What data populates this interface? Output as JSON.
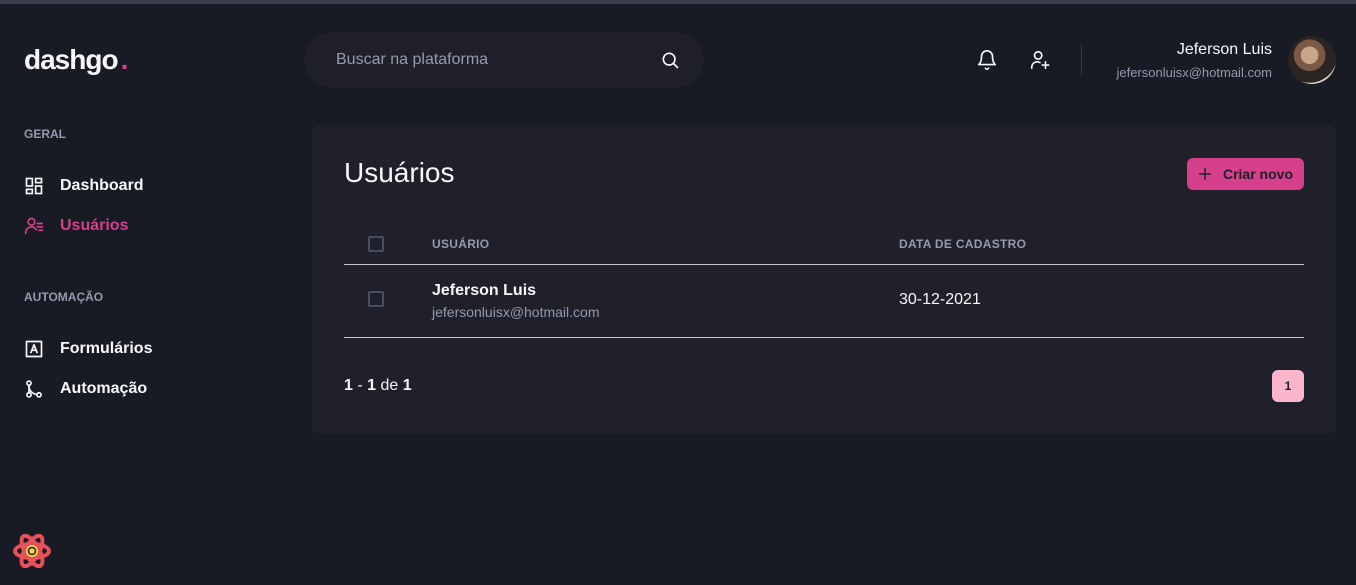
{
  "header": {
    "logo_text": "dashgo",
    "logo_dot": ".",
    "search_placeholder": "Buscar na plataforma",
    "user": {
      "name": "Jeferson Luis",
      "email": "jefersonluisx@hotmail.com"
    }
  },
  "sidebar": {
    "sections": [
      {
        "title": "GERAL",
        "items": [
          {
            "label": "Dashboard",
            "icon": "dashboard-icon",
            "active": false
          },
          {
            "label": "Usuários",
            "icon": "users-icon",
            "active": true
          }
        ]
      },
      {
        "title": "AUTOMAÇÃO",
        "items": [
          {
            "label": "Formulários",
            "icon": "form-icon",
            "active": false
          },
          {
            "label": "Automação",
            "icon": "git-merge-icon",
            "active": false
          }
        ]
      }
    ]
  },
  "main": {
    "title": "Usuários",
    "create_button": "Criar novo",
    "table": {
      "columns": [
        "USUÁRIO",
        "DATA DE CADASTRO"
      ],
      "rows": [
        {
          "name": "Jeferson Luis",
          "email": "jefersonluisx@hotmail.com",
          "date": "30-12-2021"
        }
      ]
    },
    "pagination": {
      "start": "1",
      "sep": " - ",
      "end": "1",
      "of_label": " de ",
      "total": "1",
      "current_page": "1"
    }
  },
  "colors": {
    "accent": "#D53F8C",
    "accent_light": "#FBB6CE",
    "background": "#181B23",
    "card": "#1F2029",
    "muted": "#9699B0"
  }
}
